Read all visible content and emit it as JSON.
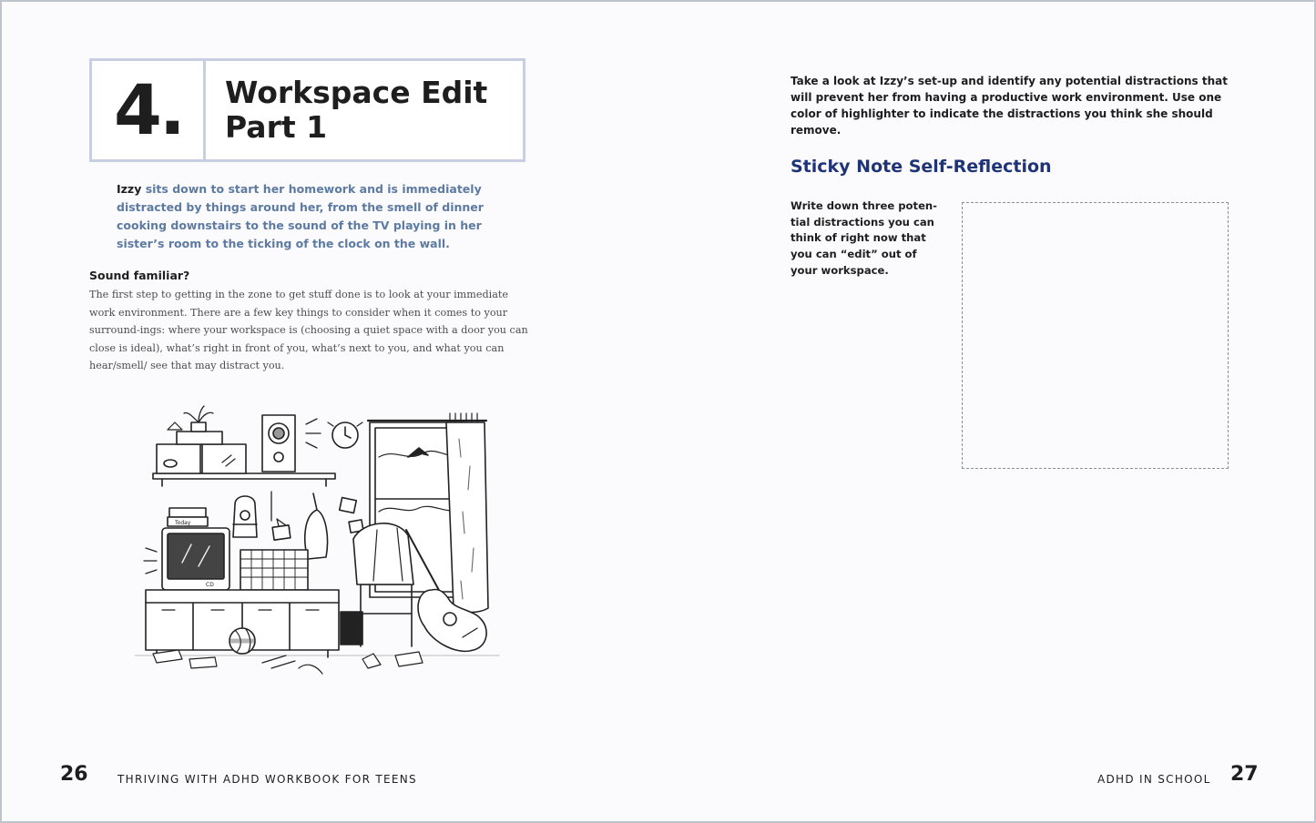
{
  "left_page": {
    "chapter_number": "4.",
    "title_line1": "Workspace Edit",
    "title_line2": "Part 1",
    "intro_lead": "Izzy",
    "intro_rest": " sits down to start her homework and is immediately distracted by things around her, from the smell of dinner cooking downstairs to the sound of the TV playing in her sister’s room to the ticking of the clock on the wall.",
    "subheading": "Sound familiar?",
    "body": "The first step to getting in the zone to get stuff done is to look at your immediate work environment. There are a few key things to consider when it comes to your surround-ings: where your workspace is (choosing a quiet space with a door you can close is ideal), what’s right in front of you, what’s next to you, and what you can hear/smell/ see that may distract you.",
    "illustration_labels": {
      "books": "Today",
      "tv_brand": "CD"
    },
    "page_number": "26",
    "running_title": "THRIVING WITH ADHD WORKBOOK FOR TEENS"
  },
  "right_page": {
    "instructions": "Take a look at Izzy’s set-up and identify any potential distractions that will prevent her from having a productive work environment. Use one color of highlighter to indicate the distractions you think she should remove.",
    "section_heading": "Sticky Note Self-Reflection",
    "reflection_prompt": "Write down three poten-tial distractions you can think of right now that you can “edit” out of your workspace.",
    "page_number": "27",
    "running_title": "ADHD IN SCHOOL"
  },
  "colors": {
    "accent_blue": "#5d7aa2",
    "heading_navy": "#1f3477",
    "title_box_border": "#c8cfe3"
  },
  "icons": [
    "room-illustration",
    "clock-icon",
    "guitar-icon",
    "tv-icon",
    "speaker-icon"
  ]
}
